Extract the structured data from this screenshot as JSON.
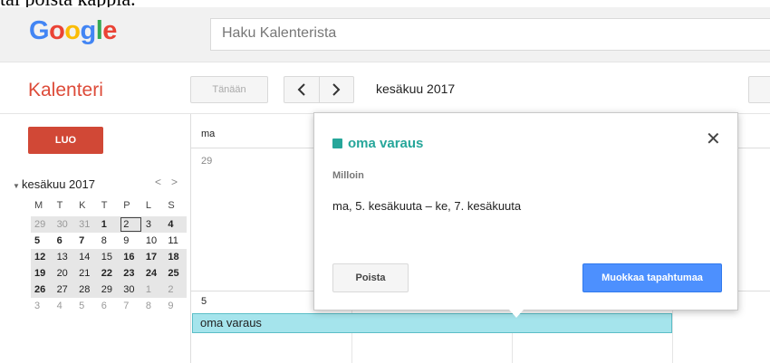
{
  "caption": "tai poista kappia.",
  "logo": {
    "letters": [
      "G",
      "o",
      "o",
      "g",
      "l",
      "e"
    ],
    "colors": [
      "#4285f4",
      "#ea4335",
      "#fbbc05",
      "#4285f4",
      "#34a853",
      "#ea4335"
    ]
  },
  "search": {
    "placeholder": "Haku Kalenterista"
  },
  "app": {
    "name": "Kalenteri"
  },
  "toolbar": {
    "today_label": "Tänään",
    "period": "kesäkuu 2017"
  },
  "sidebar": {
    "create_label": "LUO",
    "mini_month": "kesäkuu 2017",
    "weekdays": [
      "M",
      "T",
      "K",
      "T",
      "P",
      "L",
      "S"
    ],
    "weeks": [
      [
        "29",
        "30",
        "31",
        "1",
        "2",
        "3",
        "4"
      ],
      [
        "5",
        "6",
        "7",
        "8",
        "9",
        "10",
        "11"
      ],
      [
        "12",
        "13",
        "14",
        "15",
        "16",
        "17",
        "18"
      ],
      [
        "19",
        "20",
        "21",
        "22",
        "23",
        "24",
        "25"
      ],
      [
        "26",
        "27",
        "28",
        "29",
        "30",
        "1",
        "2"
      ],
      [
        "3",
        "4",
        "5",
        "6",
        "7",
        "8",
        "9"
      ]
    ]
  },
  "grid": {
    "day_header": "ma",
    "first_date": "29",
    "second_date": "5"
  },
  "event": {
    "title": "oma varaus"
  },
  "popup": {
    "title": "oma varaus",
    "when_label": "Milloin",
    "when_value": "ma, 5. kesäkuuta – ke, 7. kesäkuuta",
    "delete_label": "Poista",
    "edit_label": "Muokkaa tapahtumaa"
  },
  "colors": {
    "accent": "#26a69a",
    "create": "#d14836",
    "primary": "#4d90fe",
    "event_fill": "#a5e4ec"
  }
}
